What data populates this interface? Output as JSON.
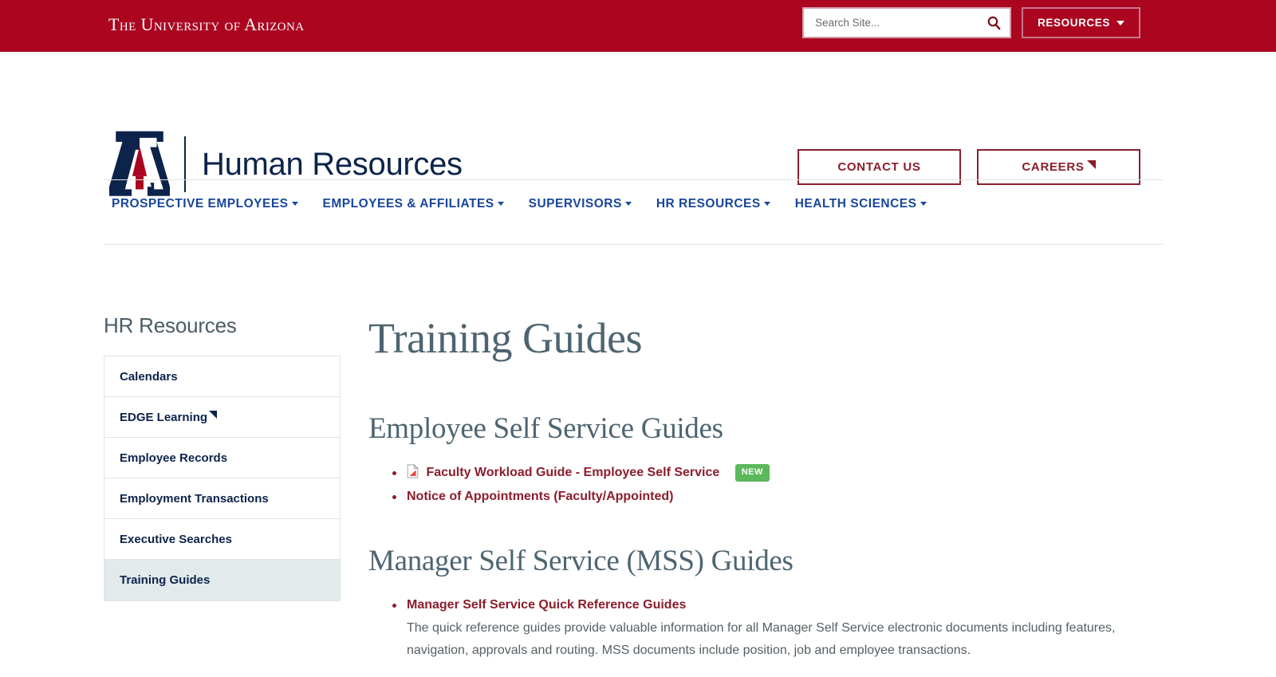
{
  "topbar": {
    "wordmark": "The University of Arizona",
    "search": {
      "placeholder": "Search Site...",
      "value": "",
      "icon": "search-icon"
    },
    "resources_label": "RESOURCES"
  },
  "brand": {
    "logo_alt": "University of Arizona block A",
    "department": "Human Resources",
    "buttons": [
      {
        "label": "CONTACT US",
        "external": false
      },
      {
        "label": "CAREERS",
        "external": true
      }
    ]
  },
  "mainnav": [
    {
      "label": "PROSPECTIVE EMPLOYEES",
      "has_dropdown": true
    },
    {
      "label": "EMPLOYEES & AFFILIATES",
      "has_dropdown": true
    },
    {
      "label": "SUPERVISORS",
      "has_dropdown": true
    },
    {
      "label": "HR RESOURCES",
      "has_dropdown": true
    },
    {
      "label": "HEALTH SCIENCES",
      "has_dropdown": true
    }
  ],
  "sidebar": {
    "title": "HR Resources",
    "items": [
      {
        "label": "Calendars",
        "active": false,
        "external": false
      },
      {
        "label": "EDGE Learning",
        "active": false,
        "external": true
      },
      {
        "label": "Employee Records",
        "active": false,
        "external": false
      },
      {
        "label": "Employment Transactions",
        "active": false,
        "external": false
      },
      {
        "label": "Executive Searches",
        "active": false,
        "external": false
      },
      {
        "label": "Training Guides",
        "active": true,
        "external": false
      }
    ]
  },
  "main": {
    "page_title": "Training Guides",
    "sections": [
      {
        "heading": "Employee Self Service Guides",
        "items": [
          {
            "label": "Faculty Workload Guide - Employee Self Service",
            "icon": "pdf-icon",
            "badge": "NEW",
            "description": ""
          },
          {
            "label": "Notice of Appointments (Faculty/Appointed)",
            "icon": "",
            "badge": "",
            "description": ""
          }
        ]
      },
      {
        "heading": "Manager Self Service (MSS) Guides",
        "items": [
          {
            "label": "Manager Self Service Quick Reference Guides",
            "icon": "",
            "badge": "",
            "description": "The quick reference guides provide valuable information for all Manager Self Service electronic documents including features, navigation, approvals and routing.  MSS documents include position, job and employee transactions."
          }
        ]
      }
    ]
  },
  "colors": {
    "brand_red": "#AB0520",
    "brand_navy": "#0C234B",
    "link_red": "#8C1D2B",
    "nav_blue": "#18469B",
    "heading_slate": "#4E6571",
    "badge_green": "#5cb85c"
  }
}
